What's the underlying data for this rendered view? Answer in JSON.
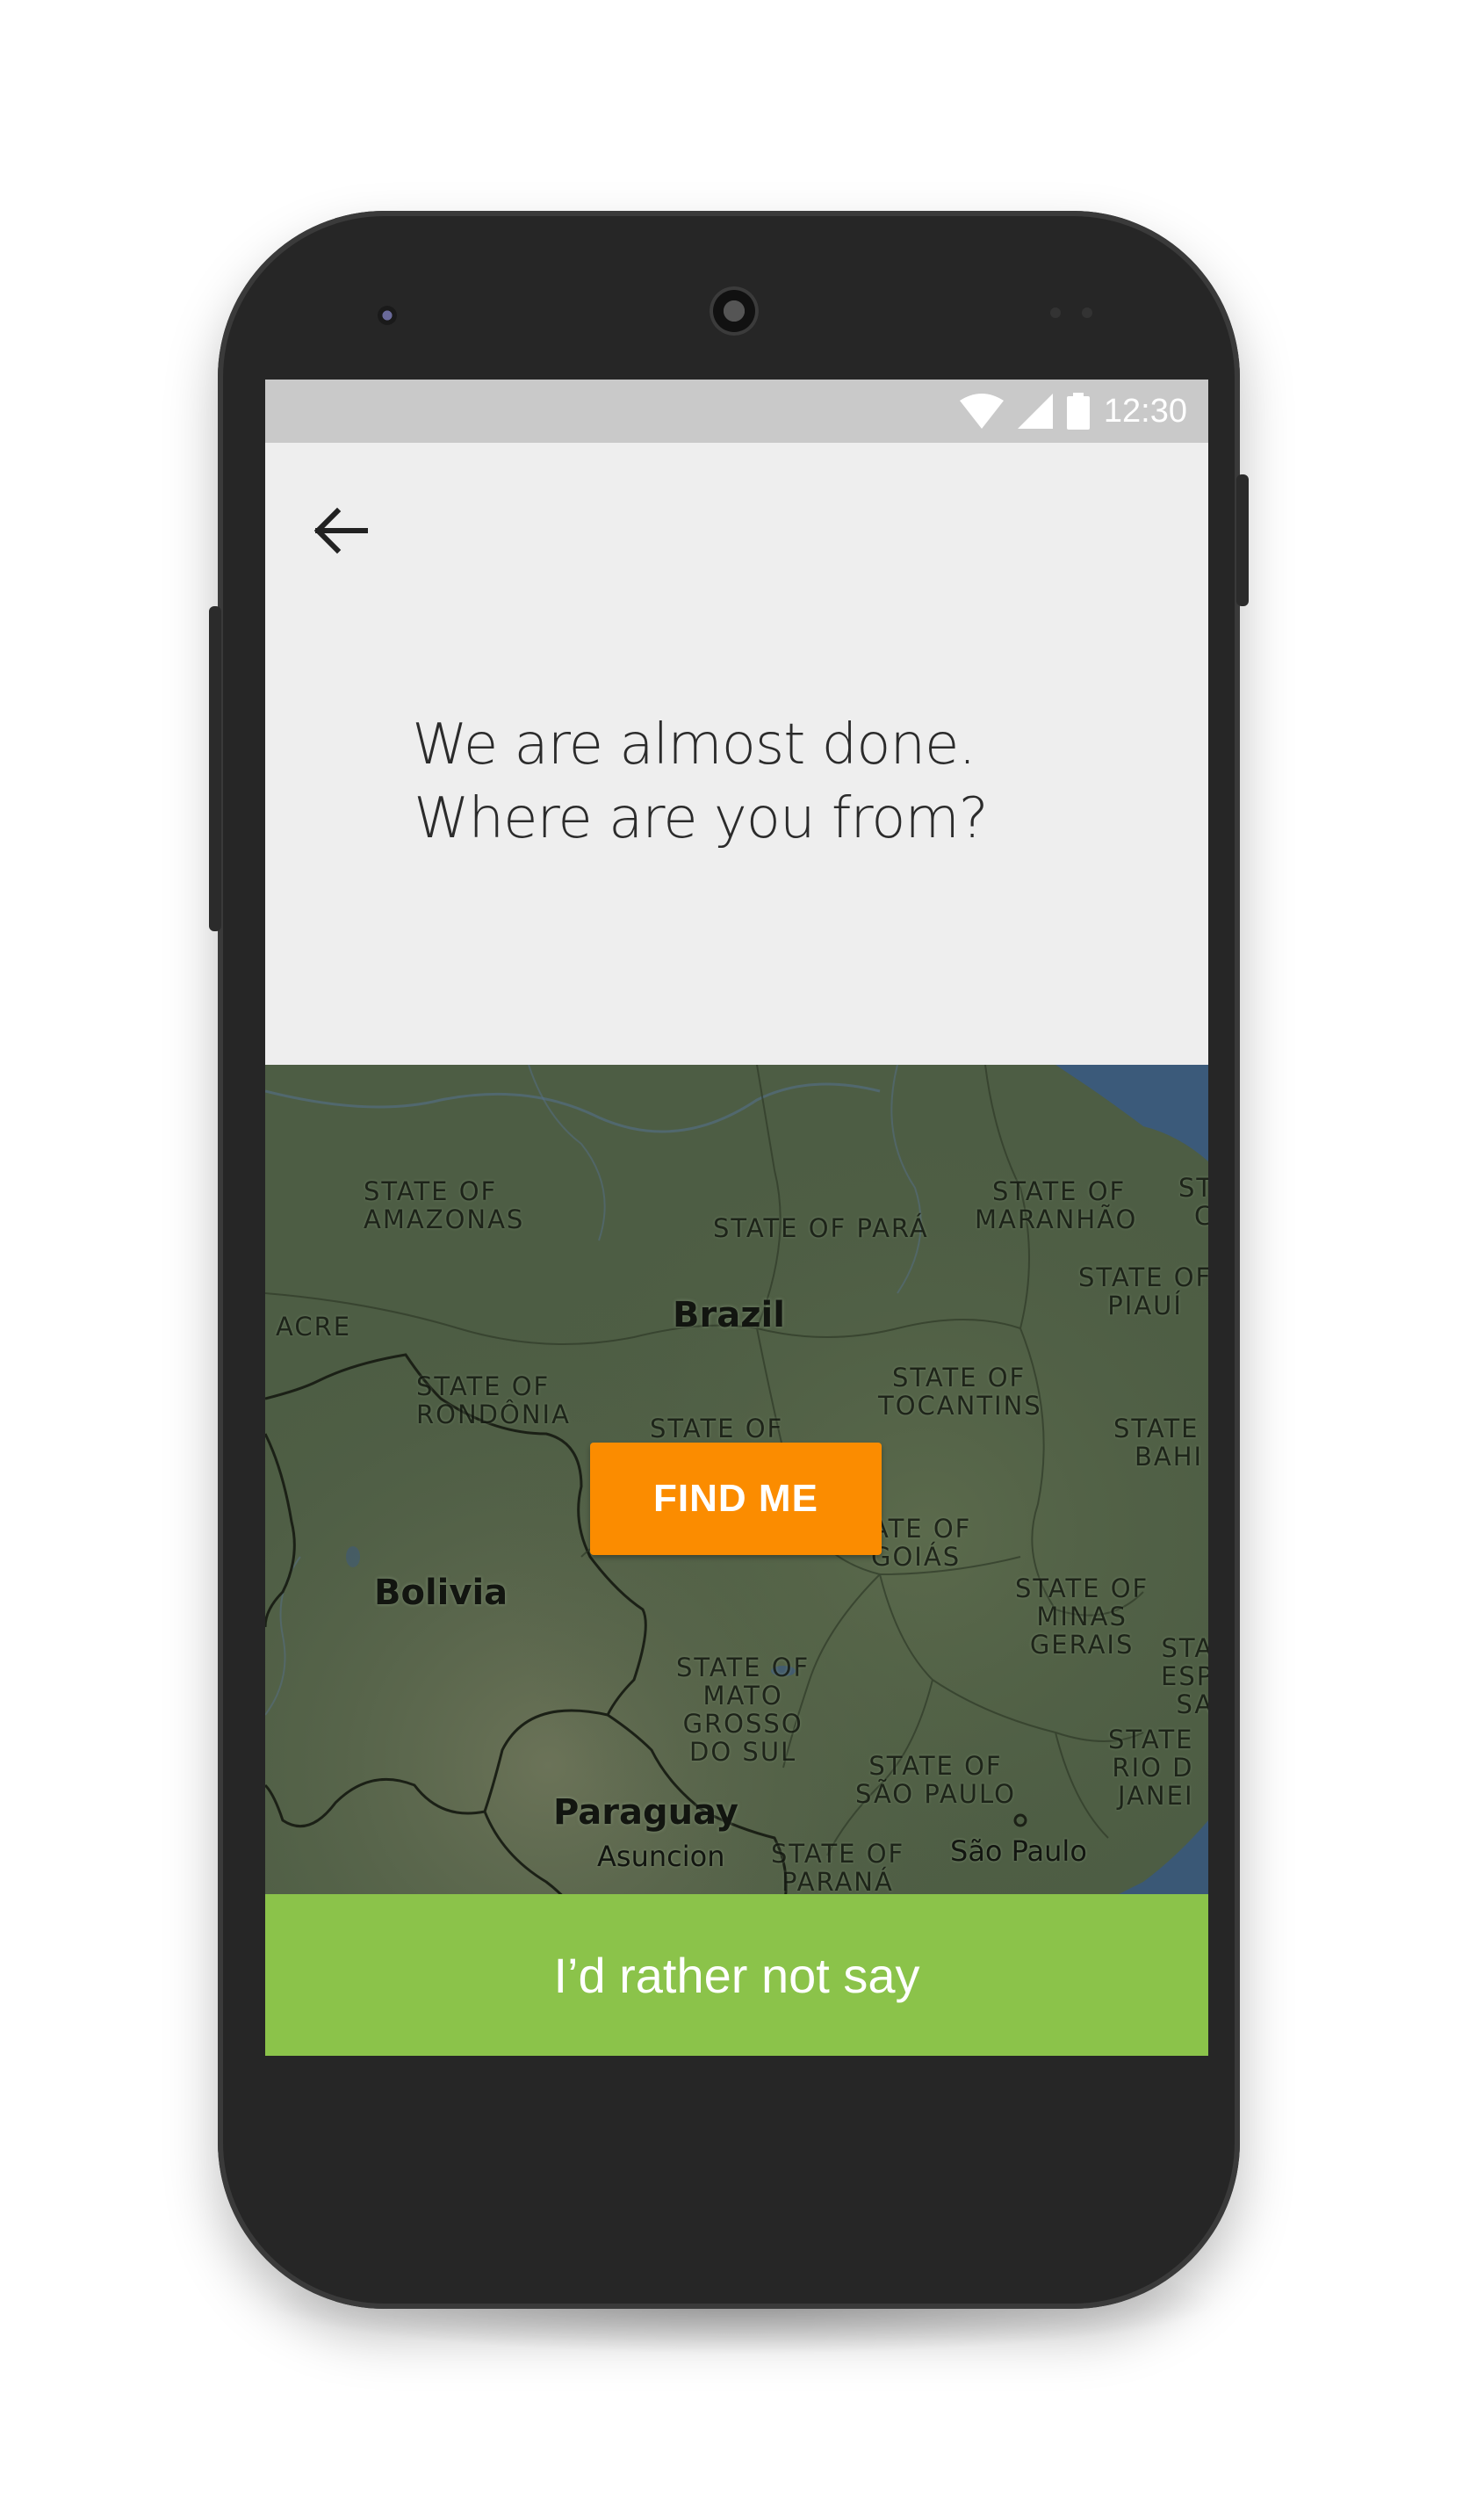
{
  "status_bar": {
    "time": "12:30",
    "icons": [
      "wifi-icon",
      "cell-signal-icon",
      "battery-icon"
    ]
  },
  "header": {
    "back_icon": "arrow-left-icon"
  },
  "prompt": {
    "line1": "We are almost done.",
    "line2": "Where are you from?"
  },
  "map": {
    "countries": [
      "Brazil",
      "Bolivia",
      "Paraguay"
    ],
    "cities": [
      "Asuncion",
      "São Paulo"
    ],
    "labels": {
      "amazonas": [
        "STATE OF",
        "AMAZONAS"
      ],
      "para": "STATE OF PARÁ",
      "maranhao": [
        "STATE OF",
        "MARANHÃO"
      ],
      "piaui": [
        "STATE OF",
        "PIAUÍ"
      ],
      "acre": "ACRE",
      "rondonia": [
        "STATE OF",
        "RONDÔNIA"
      ],
      "mato_grosso": "STATE OF",
      "tocantins": [
        "STATE OF",
        "TOCANTINS"
      ],
      "bahia": [
        "STATE",
        "BAHI"
      ],
      "goias": [
        "ATE OF",
        "GOIÁS"
      ],
      "minas": [
        "STATE OF",
        "MINAS",
        "GERAIS"
      ],
      "espirito": [
        "STA",
        "ESP",
        "SA"
      ],
      "ms": [
        "STATE OF",
        "MATO",
        "GROSSO",
        "DO SUL"
      ],
      "rio": [
        "STATE",
        "RIO D",
        "JANEI"
      ],
      "sao_paulo_state": [
        "STATE OF",
        "SÃO PAULO"
      ],
      "parana": [
        "STATE OF",
        "PARANÁ"
      ],
      "st_corner": [
        "ST",
        "C"
      ]
    }
  },
  "find_button": {
    "label": "FIND ME",
    "color": "#FB8C00"
  },
  "skip_button": {
    "label": "I’d rather not say",
    "color": "#8BC34A"
  },
  "colors": {
    "status_bar": "#C9C9C9",
    "panel": "#EEEEEE",
    "map_tint": "#4E5D45",
    "phone_body": "#262626"
  }
}
